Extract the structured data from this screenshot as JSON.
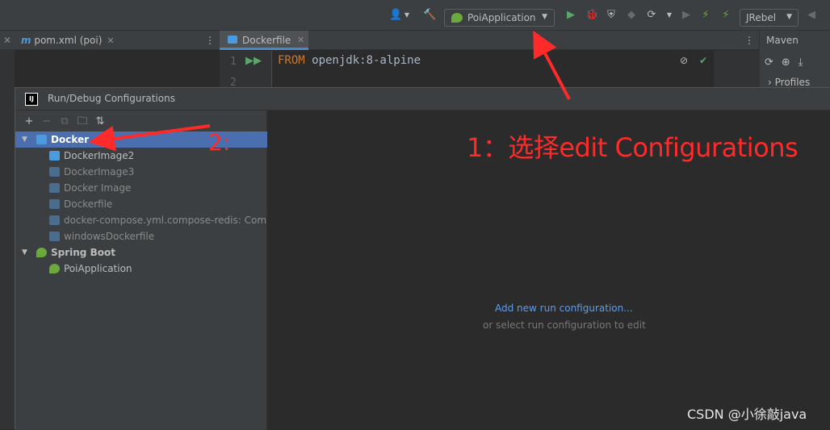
{
  "toolbar": {
    "run_config": "PoiApplication",
    "jrebel": "JRebel"
  },
  "tabs": {
    "pom": "pom.xml (poi)",
    "dockerfile": "Dockerfile"
  },
  "editor": {
    "line1": "1",
    "line2": "2",
    "code_kw": "FROM",
    "code_rest": " openjdk:8-alpine"
  },
  "maven": {
    "title": "Maven",
    "profiles": "Profiles"
  },
  "dialog": {
    "title": "Run/Debug Configurations",
    "tree": {
      "docker_group": "Docker",
      "items": [
        "DockerImage2",
        "DockerImage3",
        "Docker Image",
        "Dockerfile",
        "docker-compose.yml.compose-redis: Comp",
        "windowsDockerfile"
      ],
      "springboot_group": "Spring Boot",
      "spring_item": "PoiApplication"
    },
    "add_new": "Add new run configuration...",
    "or_select": "or select run configuration to edit"
  },
  "annotations": {
    "note1": "1：选择edit Configurations",
    "note2": "2:"
  },
  "watermark": "CSDN @小徐敲java",
  "colors": {
    "accent": "#4b6eaf",
    "link": "#589df6",
    "annotation": "#ff2a2a"
  }
}
